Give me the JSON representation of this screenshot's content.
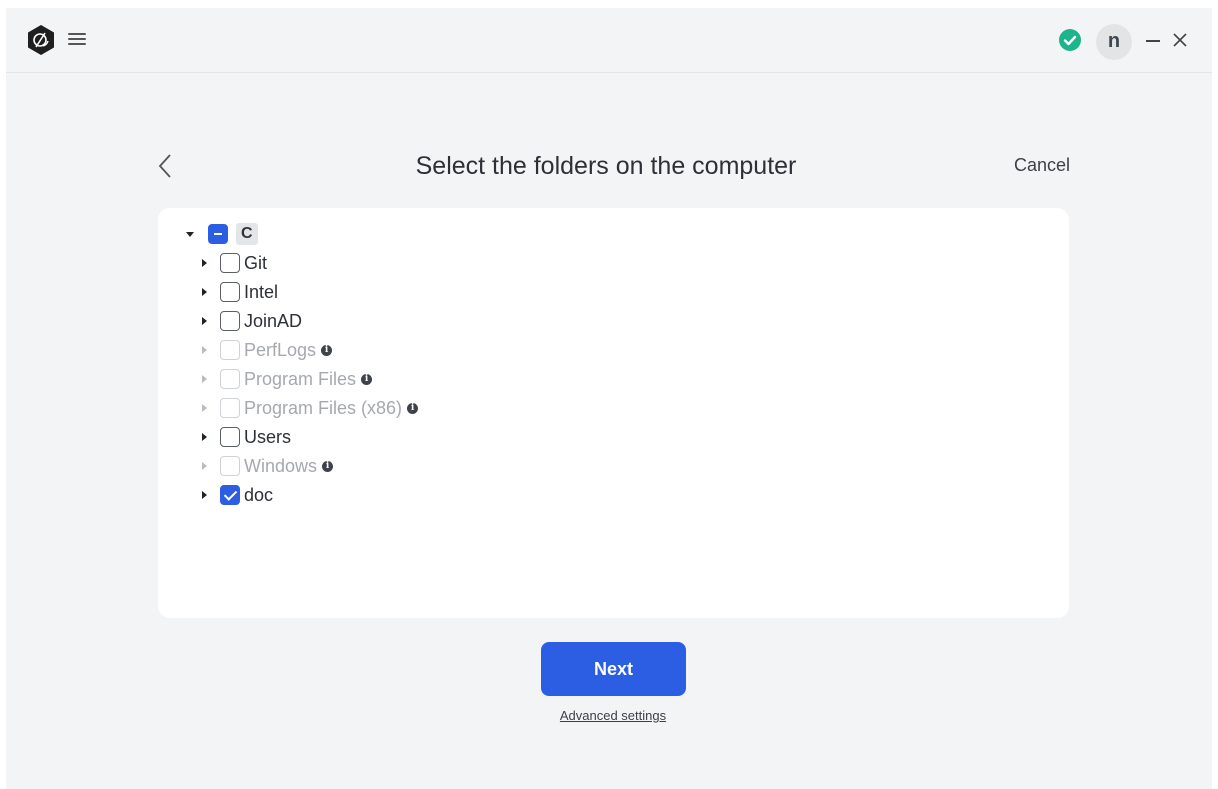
{
  "header": {
    "avatar_initial": "n",
    "status_color": "#1db48d"
  },
  "page": {
    "title": "Select the folders on the computer",
    "cancel_label": "Cancel"
  },
  "tree": {
    "root": {
      "label": "C",
      "state": "partial"
    },
    "items": [
      {
        "label": "Git",
        "checked": false,
        "disabled": false,
        "info": false
      },
      {
        "label": "Intel",
        "checked": false,
        "disabled": false,
        "info": false
      },
      {
        "label": "JoinAD",
        "checked": false,
        "disabled": false,
        "info": false
      },
      {
        "label": "PerfLogs",
        "checked": false,
        "disabled": true,
        "info": true
      },
      {
        "label": "Program Files",
        "checked": false,
        "disabled": true,
        "info": true
      },
      {
        "label": "Program Files (x86)",
        "checked": false,
        "disabled": true,
        "info": true
      },
      {
        "label": "Users",
        "checked": false,
        "disabled": false,
        "info": false
      },
      {
        "label": "Windows",
        "checked": false,
        "disabled": true,
        "info": true
      },
      {
        "label": "doc",
        "checked": true,
        "disabled": false,
        "info": false
      }
    ],
    "info_glyph": "i"
  },
  "footer": {
    "next_label": "Next",
    "advanced_label": "Advanced settings"
  },
  "colors": {
    "accent": "#2b5ee3",
    "background": "#f3f4f5"
  }
}
